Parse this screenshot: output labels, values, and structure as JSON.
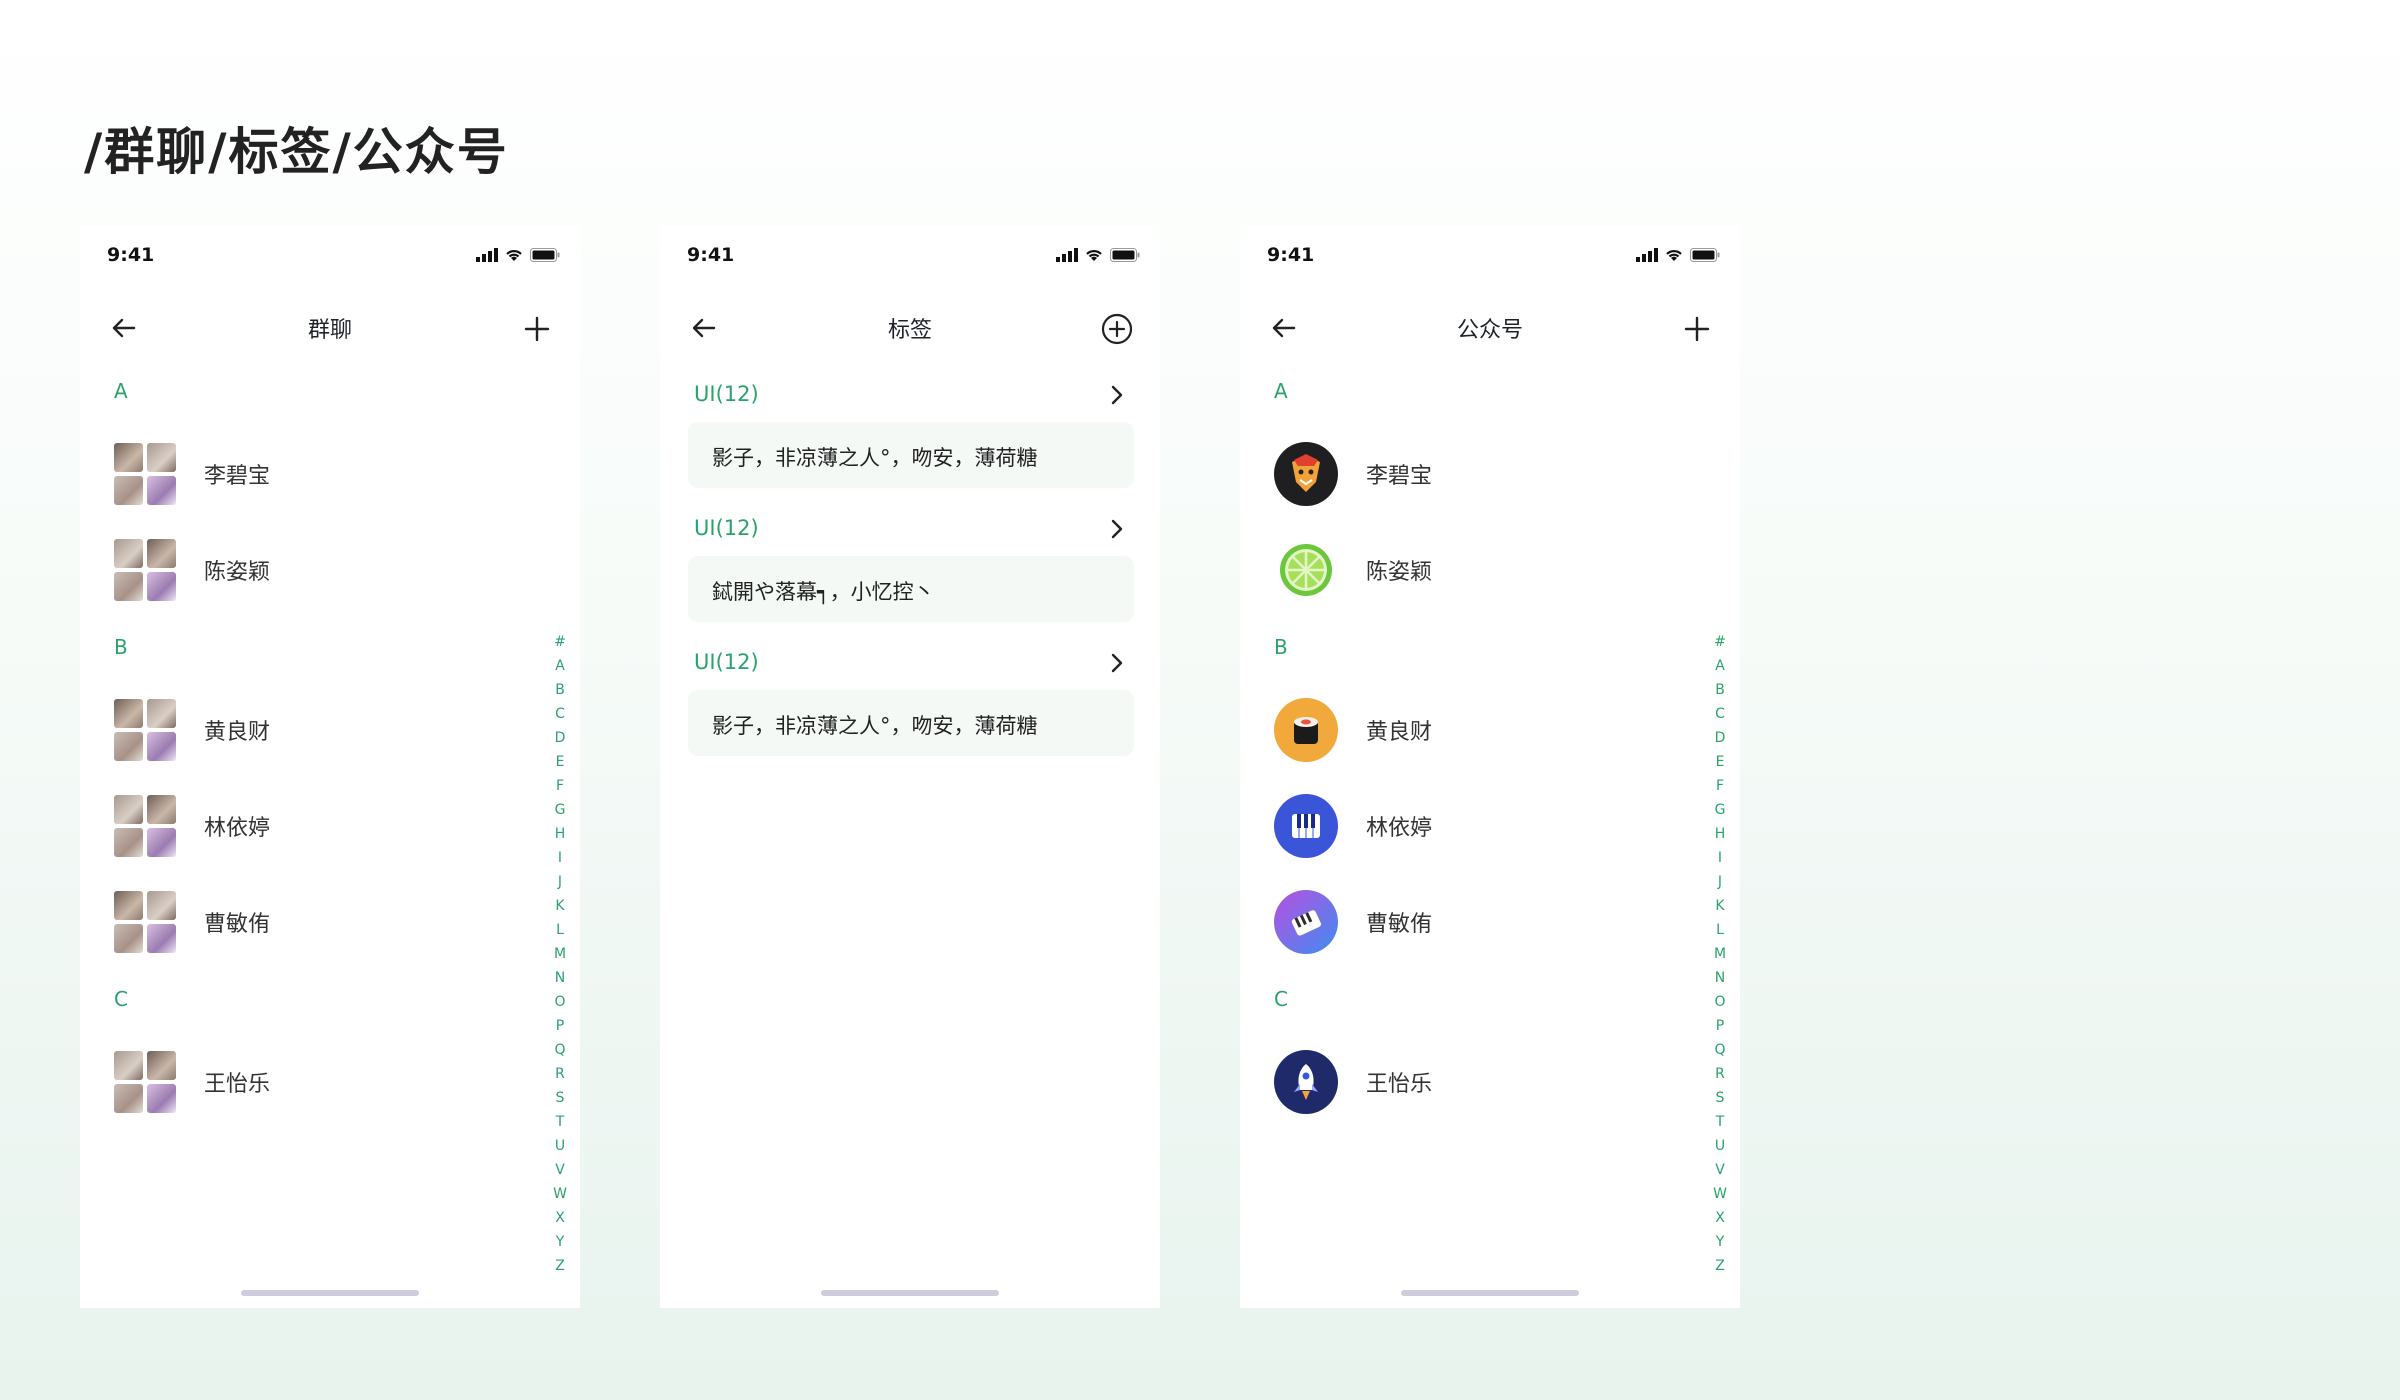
{
  "page_title": "/群聊/标签/公众号",
  "accent_color": "#2aa36b",
  "screens": [
    {
      "status_time": "9:41",
      "nav": {
        "title": "群聊",
        "back_icon": "arrow-left-icon",
        "action_icon": "plus-icon"
      },
      "sections": [
        {
          "letter": "A",
          "items": [
            {
              "name": "李碧宝"
            },
            {
              "name": "陈姿颖"
            }
          ]
        },
        {
          "letter": "B",
          "items": [
            {
              "name": "黄良财"
            },
            {
              "name": "林依婷"
            },
            {
              "name": "曹敏侑"
            }
          ]
        },
        {
          "letter": "C",
          "items": [
            {
              "name": "王怡乐"
            }
          ]
        }
      ]
    },
    {
      "status_time": "9:41",
      "nav": {
        "title": "标签",
        "back_icon": "arrow-left-icon",
        "action_icon": "plus-circle-icon"
      },
      "tags": [
        {
          "label": "UI(12)",
          "members": "影子，非凉薄之人°，吻安，薄荷糖"
        },
        {
          "label": "UI(12)",
          "members": "鋱開や落幕┑，小忆控丶"
        },
        {
          "label": "UI(12)",
          "members": "影子，非凉薄之人°，吻安，薄荷糖"
        }
      ]
    },
    {
      "status_time": "9:41",
      "nav": {
        "title": "公众号",
        "back_icon": "arrow-left-icon",
        "action_icon": "plus-icon"
      },
      "sections": [
        {
          "letter": "A",
          "items": [
            {
              "name": "李碧宝",
              "icon": "fox-icon"
            },
            {
              "name": "陈姿颖",
              "icon": "lime-icon"
            }
          ]
        },
        {
          "letter": "B",
          "items": [
            {
              "name": "黄良财",
              "icon": "sushi-icon"
            },
            {
              "name": "林依婷",
              "icon": "piano-icon"
            },
            {
              "name": "曹敏侑",
              "icon": "keys-icon"
            }
          ]
        },
        {
          "letter": "C",
          "items": [
            {
              "name": "王怡乐",
              "icon": "rocket-icon"
            }
          ]
        }
      ]
    }
  ],
  "index_letters": [
    "#",
    "A",
    "B",
    "C",
    "D",
    "E",
    "F",
    "G",
    "H",
    "I",
    "J",
    "K",
    "L",
    "M",
    "N",
    "O",
    "P",
    "Q",
    "R",
    "S",
    "T",
    "U",
    "V",
    "W",
    "X",
    "Y",
    "Z"
  ]
}
